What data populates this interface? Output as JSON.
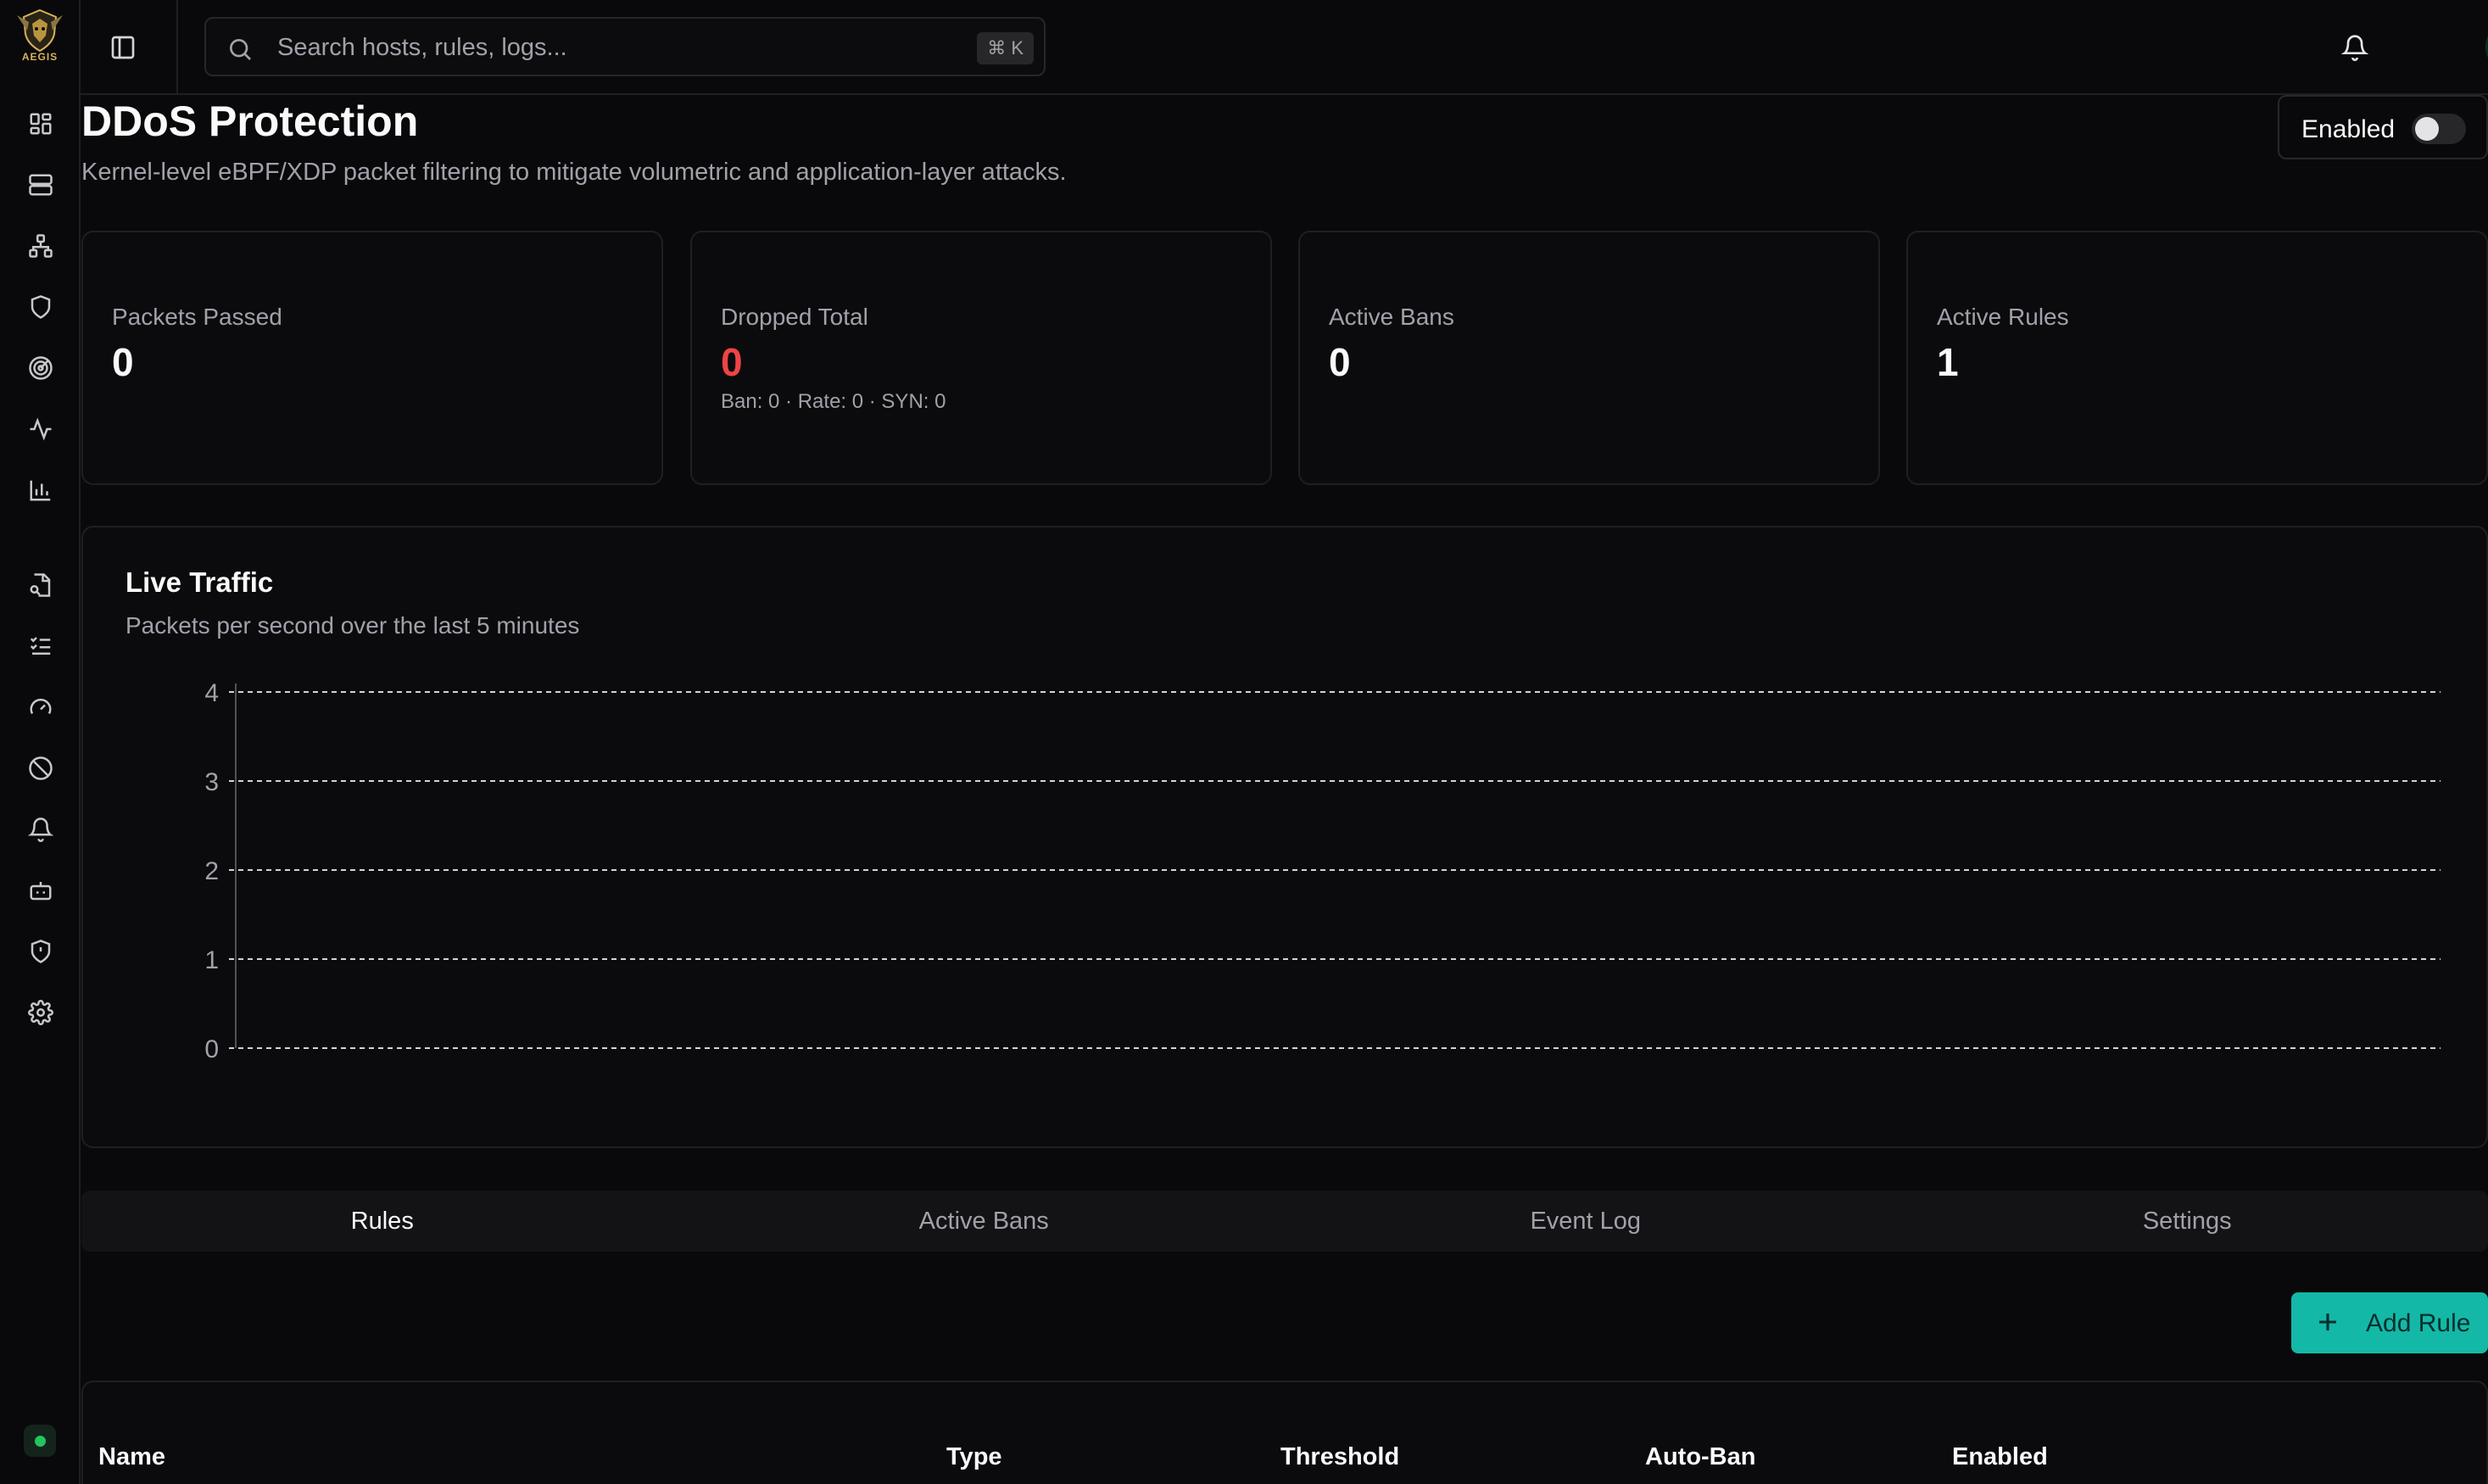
{
  "app": {
    "logo_text": "AEGIS"
  },
  "nav": {
    "icons": [
      "dashboard-icon",
      "server-icon",
      "network-icon",
      "shield-icon",
      "radar-icon",
      "activity-icon",
      "bar-chart-icon",
      "file-key-icon",
      "checklist-icon",
      "gauge-icon",
      "ban-icon",
      "bell-icon",
      "bot-icon",
      "shield-alert-icon",
      "settings-icon"
    ]
  },
  "search": {
    "placeholder": "Search hosts, rules, logs...",
    "shortcut": "⌘ K"
  },
  "page": {
    "title": "DDoS Protection",
    "subtitle": "Kernel-level eBPF/XDP packet filtering to mitigate volumetric and application-layer attacks.",
    "toggle_label": "Enabled",
    "toggle_on": false
  },
  "stats": [
    {
      "label": "Packets Passed",
      "value": "0"
    },
    {
      "label": "Dropped Total",
      "value": "0",
      "sub": "Ban: 0 · Rate: 0 · SYN: 0",
      "accent": "#ef4444"
    },
    {
      "label": "Active Bans",
      "value": "0"
    },
    {
      "label": "Active Rules",
      "value": "1"
    }
  ],
  "chart": {
    "title": "Live Traffic",
    "subtitle": "Packets per second over the last 5 minutes"
  },
  "chart_data": {
    "type": "line",
    "title": "Live Traffic",
    "subtitle": "Packets per second over the last 5 minutes",
    "xlabel": "",
    "ylabel": "",
    "ylim": [
      0,
      4
    ],
    "yticks": [
      "0",
      "1",
      "2",
      "3",
      "4"
    ],
    "grid": true,
    "series": []
  },
  "tabs": [
    {
      "label": "Rules",
      "active": true
    },
    {
      "label": "Active Bans",
      "active": false
    },
    {
      "label": "Event Log",
      "active": false
    },
    {
      "label": "Settings",
      "active": false
    }
  ],
  "actions": {
    "add_rule": "Add Rule"
  },
  "table": {
    "columns": [
      "Name",
      "Type",
      "Threshold",
      "Auto-Ban",
      "Enabled"
    ]
  },
  "colors": {
    "accent": "#14b8a6",
    "danger": "#ef4444",
    "online": "#22c55e"
  }
}
